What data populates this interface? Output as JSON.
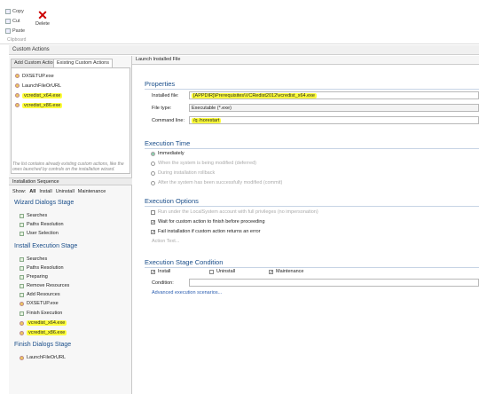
{
  "ribbon": {
    "copy_label": "Copy",
    "cut_label": "Cut",
    "paste_label": "Paste",
    "delete_label": "Delete",
    "group_label": "Clipboard"
  },
  "window": {
    "title": "Custom Actions"
  },
  "left_tabs": {
    "add_label": "Add Custom Action",
    "existing_label": "Existing Custom Actions"
  },
  "existing_actions": [
    {
      "label": "DXSETUP.exe"
    },
    {
      "label": "LaunchFileOrURL"
    },
    {
      "label": "vcredist_x64.exe"
    },
    {
      "label": "vcredist_x86.exe"
    }
  ],
  "tab_note": "The list contains already existing custom actions, like the ones launched by controls on the installation wizard.",
  "sequence": {
    "header": "Installation Sequence",
    "show_label": "Show:",
    "filters": [
      "All",
      "Install",
      "Uninstall",
      "Maintenance"
    ],
    "stages": [
      {
        "title": "Wizard Dialogs Stage",
        "items": [
          "Searches",
          "Paths Resolution",
          "User Selection"
        ]
      },
      {
        "title": "Install Execution Stage",
        "items": [
          "Searches",
          "Paths Resolution",
          "Preparing",
          "Remove Resources",
          "Add Resources",
          "DXSETUP.exe",
          "Finish Execution",
          "vcredist_x64.exe",
          "vcredist_x86.exe"
        ]
      },
      {
        "title": "Finish Dialogs Stage",
        "items": [
          "LaunchFileOrURL"
        ]
      }
    ]
  },
  "right": {
    "header": "Launch Installed File",
    "properties": {
      "title": "Properties",
      "installed_file_label": "Installed file:",
      "installed_file_value": "[APPDIR]\\Prerequisites\\VCRedist2012\\vcredist_x64.exe",
      "file_type_label": "File type:",
      "file_type_value": "Executable (*.exe)",
      "command_line_label": "Command line:",
      "command_line_value": "/q /norestart"
    },
    "execution_time": {
      "title": "Execution Time",
      "options": [
        {
          "label": "Immediately",
          "selected": true,
          "enabled": true
        },
        {
          "label": "When the system is being modified (deferred)",
          "selected": false,
          "enabled": false
        },
        {
          "label": "During installation rollback",
          "selected": false,
          "enabled": false
        },
        {
          "label": "After the system has been successfully modified (commit)",
          "selected": false,
          "enabled": false
        }
      ]
    },
    "execution_options": {
      "title": "Execution Options",
      "run_localsystem": "Run under the LocalSystem account with full privileges (no impersonation)",
      "wait_label": "Wait for custom action to finish before proceeding",
      "fail_label": "Fail installation if custom action returns an error",
      "action_text_link": "Action Text..."
    },
    "stage_condition": {
      "title": "Execution Stage Condition",
      "install_label": "Install",
      "uninstall_label": "Uninstall",
      "maintenance_label": "Maintenance",
      "condition_label": "Condition:",
      "condition_value": "",
      "advanced_link": "Advanced execution scenarios..."
    }
  },
  "colors": {
    "highlight": "#ffff3a",
    "section_title": "#1a4e8a",
    "link": "#2a5db0"
  }
}
